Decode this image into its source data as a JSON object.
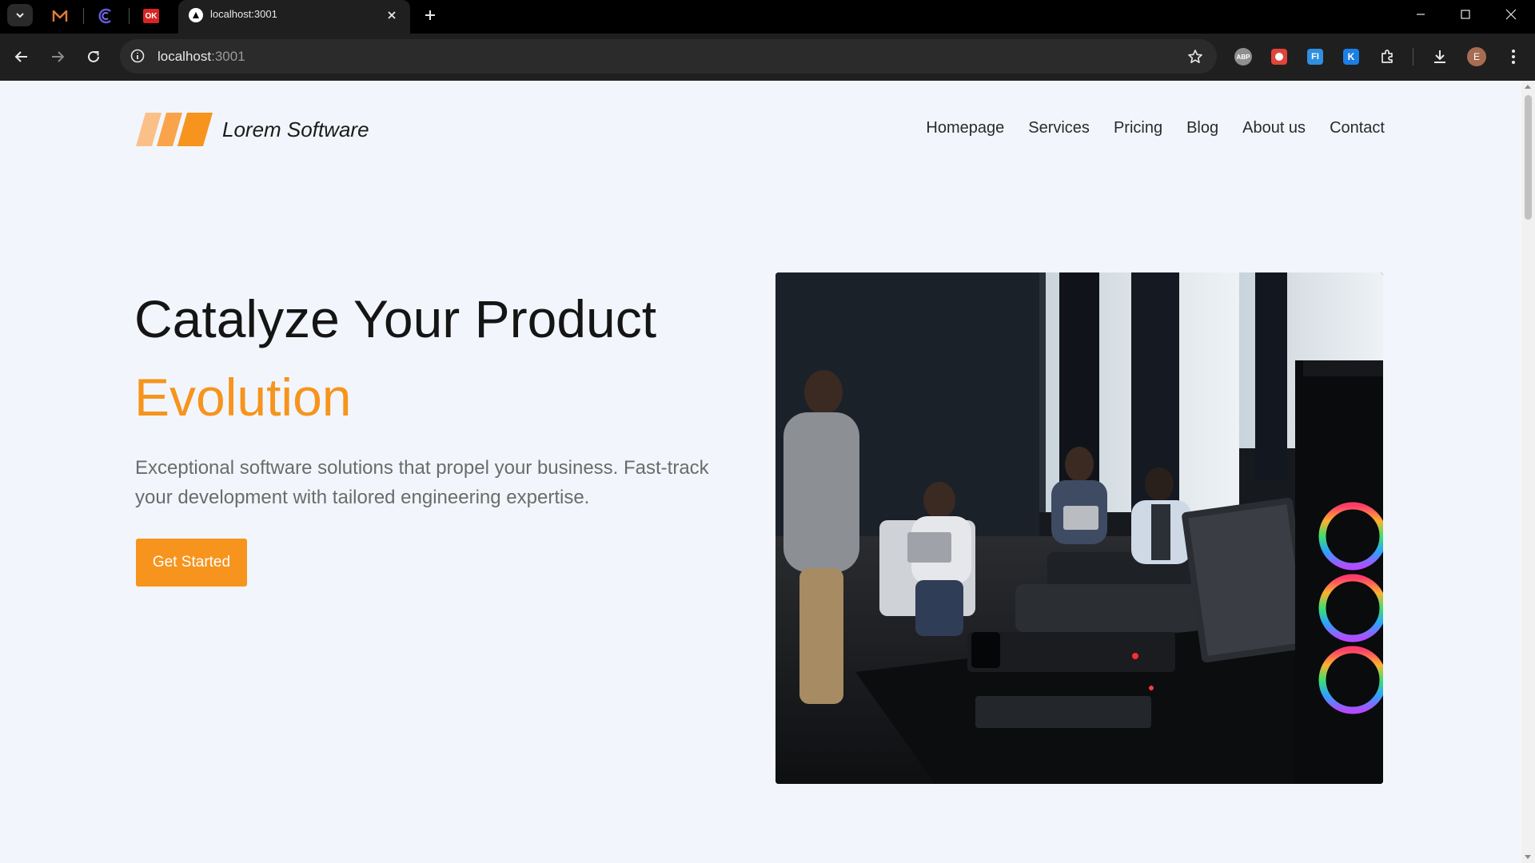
{
  "browser": {
    "tab_title": "localhost:3001",
    "pinned_tabs": [
      {
        "icon": "gmail-icon"
      },
      {
        "icon": "c-app-icon"
      },
      {
        "icon": "ok-app-icon",
        "label": "OK"
      }
    ],
    "url_host": "localhost",
    "url_port": ":3001",
    "extensions": [
      {
        "icon": "adblock-icon",
        "label": "ABP"
      },
      {
        "icon": "ext-red-icon"
      },
      {
        "icon": "ext-fi-icon",
        "label": "FI"
      },
      {
        "icon": "ext-k-icon",
        "label": "K"
      }
    ],
    "profile_initial": "E"
  },
  "site": {
    "brand": "Lorem Software",
    "nav": [
      "Homepage",
      "Services",
      "Pricing",
      "Blog",
      "About us",
      "Contact"
    ],
    "hero": {
      "title": "Catalyze Your Product",
      "accent": "Evolution",
      "subtitle": "Exceptional software solutions that propel your business. Fast-track your development with tailored engineering expertise.",
      "cta": "Get Started"
    },
    "colors": {
      "accent": "#f7941d",
      "background": "#f2f6fc"
    }
  }
}
